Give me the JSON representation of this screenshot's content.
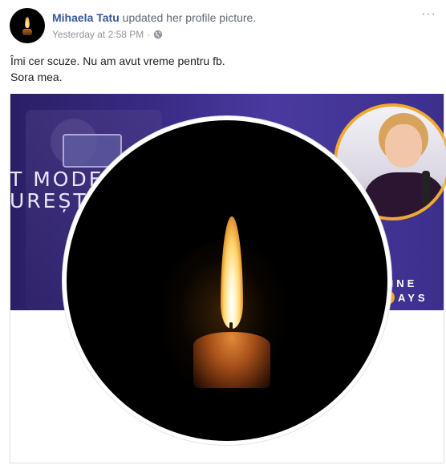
{
  "post": {
    "author": "Mihaela Tatu",
    "action": "updated her profile picture.",
    "timestamp": "Yesterday at 2:58 PM",
    "separator": "·",
    "privacy_icon": "globe-icon",
    "more_icon": "more-options-icon",
    "more_glyph": "···",
    "message_line1": "Îmi cer scuze. Nu am avut vreme pentru fb.",
    "message_line2": "Sora mea."
  },
  "cover": {
    "text_line1": "T MODE",
    "text_line2": "UREȘT",
    "badge_line1": "SINE",
    "badge_letter": "D",
    "badge_line2_rest": "AYS"
  },
  "profile_photo": {
    "subject": "lit candle in darkness"
  },
  "colors": {
    "author_link": "#385898",
    "meta_gray": "#90949c",
    "cover_purple": "#3a2b86",
    "accent_orange": "#f0a92c"
  }
}
